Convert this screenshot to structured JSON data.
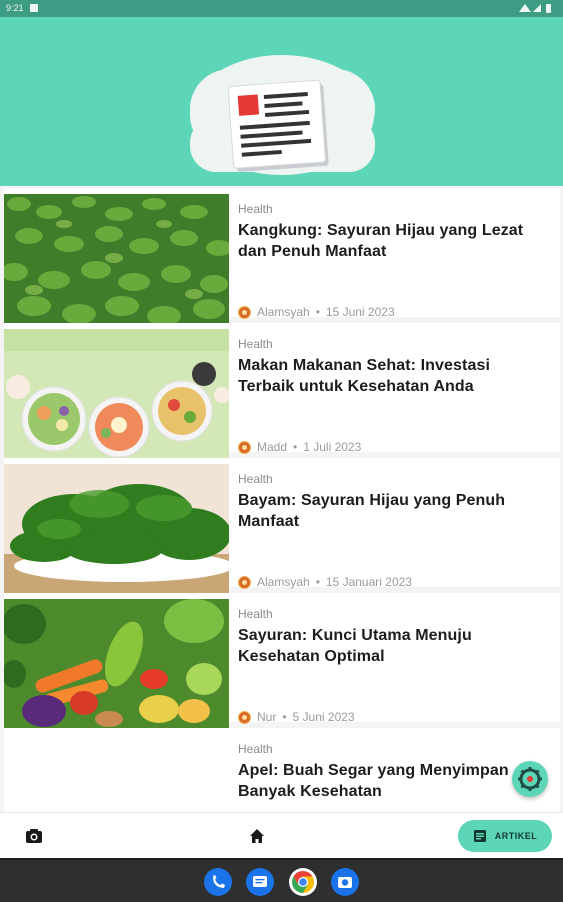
{
  "status_bar": {
    "time": "9:21"
  },
  "articles": [
    {
      "category": "Health",
      "title": "Kangkung: Sayuran Hijau yang Lezat dan Penuh Manfaat",
      "author": "Alamsyah",
      "date": "15 Juni 2023"
    },
    {
      "category": "Health",
      "title": "Makan Makanan Sehat: Investasi Terbaik untuk Kesehatan Anda",
      "author": "Madd",
      "date": "1 Juli 2023"
    },
    {
      "category": "Health",
      "title": "Bayam: Sayuran Hijau yang Penuh Manfaat",
      "author": "Alamsyah",
      "date": "15 Januari 2023"
    },
    {
      "category": "Health",
      "title": "Sayuran: Kunci Utama Menuju Kesehatan Optimal",
      "author": "Nur",
      "date": "5 Juni 2023"
    },
    {
      "category": "Health",
      "title": "Apel: Buah Segar yang Menyimpan Banyak Kesehatan",
      "author": "",
      "date": ""
    }
  ],
  "meta_separator": "•",
  "bottom_nav": {
    "camera_icon": "camera-icon",
    "home_icon": "home-icon",
    "artikel_label": "ARTIKEL",
    "artikel_icon": "article-icon"
  },
  "dock": [
    "phone-icon",
    "messages-icon",
    "chrome-icon",
    "camera-app-icon"
  ],
  "colors": {
    "primary": "#5cd6b7",
    "status_bar": "#3e9c84",
    "accent_red": "#e53935"
  }
}
